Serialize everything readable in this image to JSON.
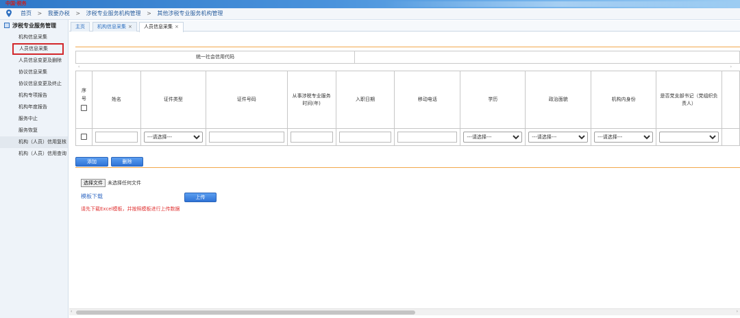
{
  "banner": {
    "logo_text": "中国·税务"
  },
  "breadcrumb": [
    "首页",
    "我要办税",
    "涉税专业服务机构管理",
    "其他涉税专业服务机构管理"
  ],
  "breadcrumb_sep": ">",
  "sidebar": {
    "title": "涉税专业服务管理",
    "items": [
      {
        "label": "机构信息采集"
      },
      {
        "label": "人员信息采集"
      },
      {
        "label": "人员信息变更及删除"
      },
      {
        "label": "协议信息采集"
      },
      {
        "label": "协议信息变更及终止"
      },
      {
        "label": "机构专项报告"
      },
      {
        "label": "机构年度报告"
      },
      {
        "label": "服务中止"
      },
      {
        "label": "服务恢复"
      },
      {
        "label": "机构（人员）信用复核"
      },
      {
        "label": "机构（人员）信用查询"
      }
    ]
  },
  "tabs": [
    {
      "label": "主页",
      "closable": false
    },
    {
      "label": "机构信息采集",
      "closable": true
    },
    {
      "label": "人员信息采集",
      "closable": true
    }
  ],
  "tab_close": "×",
  "form": {
    "credit_code_label": "统一社会信用代码"
  },
  "table": {
    "headers": {
      "seq": "序号",
      "name": "姓名",
      "id_type": "证件类型",
      "id_number": "证件号码",
      "service_years": "从事涉税专业服务时间(年)",
      "join_date": "入职日期",
      "mobile": "移动电话",
      "education": "学历",
      "political": "政治面貌",
      "role": "机构内身份",
      "party_secretary": "是否党支部书记（党组织负责人）"
    },
    "select_placeholder": "---请选择---"
  },
  "buttons": {
    "add": "添加",
    "delete": "删除",
    "upload": "上传"
  },
  "file": {
    "choose": "选择文件",
    "none": "未选择任何文件"
  },
  "template_link": "模板下载",
  "warning": "请先下载Excel模板，并按照模板进行上传数据",
  "scroll_left": "‹",
  "scroll_right": "›"
}
